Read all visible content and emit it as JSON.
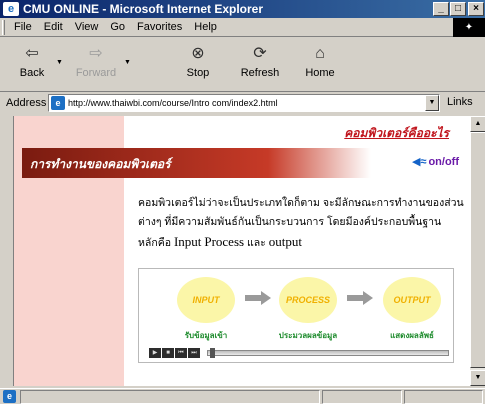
{
  "window": {
    "title": "CMU ONLINE - Microsoft Internet Explorer",
    "controls": [
      "_",
      "□",
      "×"
    ]
  },
  "menu": [
    "File",
    "Edit",
    "View",
    "Go",
    "Favorites",
    "Help"
  ],
  "toolbar": {
    "back": "Back",
    "forward": "Forward",
    "stop": "Stop",
    "refresh": "Refresh",
    "home": "Home"
  },
  "address": {
    "label": "Address",
    "url": "http://www.thaiwbi.com/course/Intro com/index2.html",
    "links_label": "Links"
  },
  "page": {
    "heading": "คอมพิวเตอร์คืออะไร",
    "banner_title": "การทำงานของคอมพิวเตอร์",
    "sound_toggle": "on/off",
    "paragraph_1": "คอมพิวเตอร์ไม่ว่าจะเป็นประเภทใดก็ตาม จะมีลักษณะการทำงานของส่วน",
    "paragraph_2": "ต่างๆ ที่มีความสัมพันธ์กันเป็นกระบวนการ โดยมีองค์ประกอบพื้นฐาน",
    "paragraph_3_prefix": "หลักคือ",
    "term_input": "Input",
    "term_process": "Process",
    "and_word": "และ",
    "term_output": "output"
  },
  "diagram": {
    "nodes": [
      {
        "label": "INPUT",
        "caption": "รับข้อมูลเข้า"
      },
      {
        "label": "PROCESS",
        "caption": "ประมวลผลข้อมูล"
      },
      {
        "label": "OUTPUT",
        "caption": "แสดงผลลัพธ์"
      }
    ],
    "player_buttons": [
      "▶",
      "■",
      "⏮",
      "⏭"
    ]
  },
  "icons": {
    "ie": "e",
    "speaker": "🔊"
  }
}
